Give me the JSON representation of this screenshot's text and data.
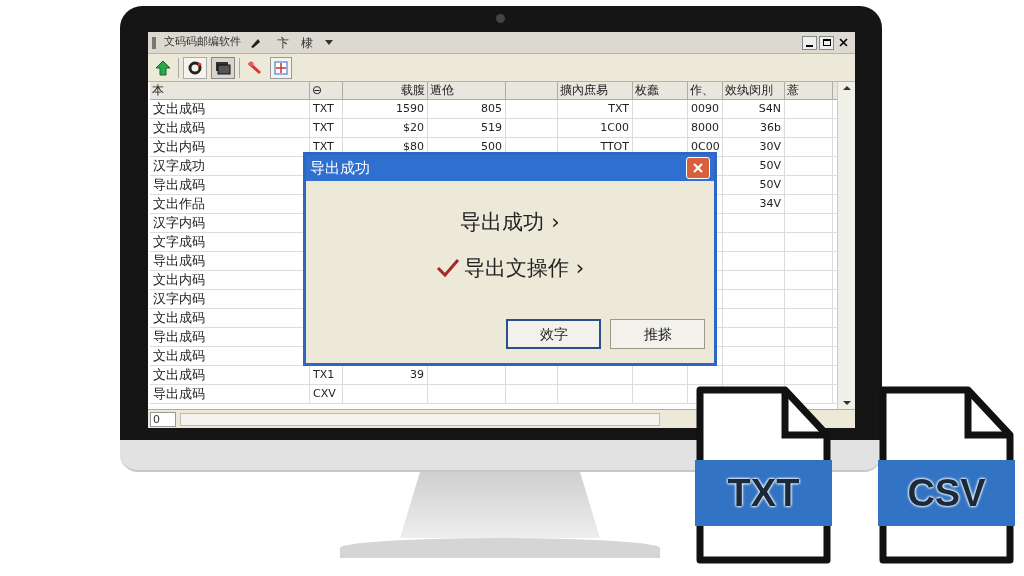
{
  "window": {
    "title": "文码码邮编软件",
    "menu": [
      "卞",
      "棣"
    ]
  },
  "table": {
    "columns": [
      {
        "label": "本"
      },
      {
        "label": "⊖"
      },
      {
        "label": "载腹"
      },
      {
        "label": "遁伧"
      },
      {},
      {
        "label": "擴內庶易"
      },
      {
        "label": "枚蠢"
      },
      {
        "label": "作、"
      },
      {
        "label": "效纨闵刖"
      },
      {
        "label": "薏"
      }
    ],
    "rows": [
      {
        "column_1": "文出成码",
        "column_2": "TXT",
        "column_3": "1590",
        "column_4": "805",
        "column_6": "TXT",
        "column_8": "0090",
        "column_9": "S4N"
      },
      {
        "column_1": "文出成码",
        "column_2": "TXT",
        "column_3": "$20",
        "column_4": "519",
        "column_6": "1C00",
        "column_8": "8000",
        "column_9": "36b"
      },
      {
        "column_1": "文出内码",
        "column_2": "TXT",
        "column_3": "$80",
        "column_4": "500",
        "column_6": "TTOT",
        "column_8": "0C00",
        "column_9": "30V"
      },
      {
        "column_1": "汉字成功",
        "column_9": "50V"
      },
      {
        "column_1": "导出成码",
        "column_9": "50V"
      },
      {
        "column_1": "文出作品",
        "column_9": "34V"
      },
      {
        "column_1": "汉字内码"
      },
      {
        "column_1": "文字成码"
      },
      {
        "column_1": "导出成码"
      },
      {
        "column_1": "文出内码"
      },
      {
        "column_1": "汉字内码"
      },
      {
        "column_1": "文出成码"
      },
      {
        "column_1": "导出成码"
      },
      {
        "column_1": "文出成码"
      },
      {
        "column_1": "文出成码",
        "column_2": "TX1",
        "column_3": "39"
      },
      {
        "column_1": "导出成码",
        "column_2": "CXV"
      }
    ]
  },
  "status_bar": {
    "cell": "0"
  },
  "dialog": {
    "title": "导出成功",
    "lines": [
      {
        "text": "导出成功 ›",
        "checked": false
      },
      {
        "text": "导出文操作 ›",
        "checked": true
      }
    ],
    "buttons": [
      {
        "label": "效字",
        "default": true
      },
      {
        "label": "推搽",
        "default": false
      }
    ]
  },
  "file_badges": [
    {
      "label": "TXT"
    },
    {
      "label": "CSV"
    }
  ]
}
